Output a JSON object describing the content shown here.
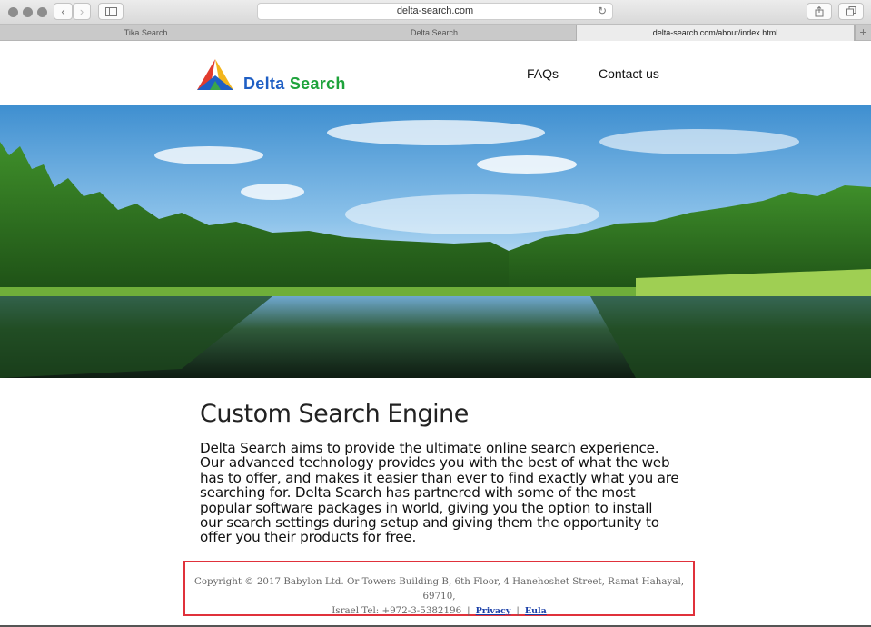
{
  "browser": {
    "url": "delta-search.com",
    "tabs": [
      {
        "label": "Tika Search"
      },
      {
        "label": "Delta Search"
      },
      {
        "label": "delta-search.com/about/index.html"
      }
    ]
  },
  "site": {
    "brand_first": "Delta ",
    "brand_second": "Search",
    "nav": [
      "FAQs",
      "Contact us"
    ],
    "heading": "Custom Search Engine",
    "body_lines": [
      "Delta Search aims to provide the ultimate online search experience.",
      "Our advanced technology provides you with the best of what the web",
      "has to offer, and makes it easier than ever to find exactly what you are",
      "searching for. Delta Search has partnered with some of the most",
      "popular software packages in world, giving you the option to install",
      "our search settings during setup and giving them the opportunity to",
      "offer you their products for free."
    ],
    "footer": {
      "line1": "Copyright © 2017 Babylon Ltd. Or Towers Building B, 6th Floor, 4 Hanehoshet Street, Ramat Hahayal, 69710,",
      "line2": "Israel Tel: +972-3-5382196",
      "separator": "|",
      "privacy": "Privacy",
      "eula": "Eula"
    }
  },
  "colors": {
    "brand_blue": "#1f5fc4",
    "brand_green": "#1ea33b",
    "highlight": "#e0313b",
    "link": "#1a3fa8"
  },
  "icons": [
    "back-icon",
    "forward-icon",
    "sidebar-icon",
    "reload-icon",
    "share-icon",
    "tabs-overview-icon",
    "add-tab-icon",
    "delta-logo"
  ]
}
